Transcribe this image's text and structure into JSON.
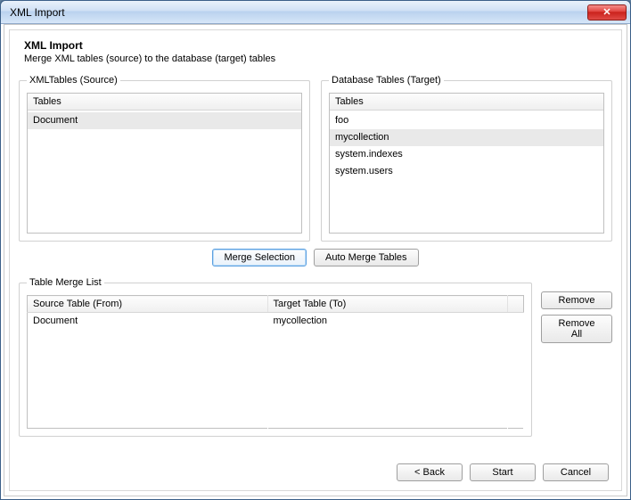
{
  "window": {
    "title": "XML Import"
  },
  "header": {
    "title": "XML Import",
    "subtitle": "Merge XML tables (source) to the database (target) tables"
  },
  "source": {
    "legend": "XMLTables (Source)",
    "column": "Tables",
    "items": [
      "Document"
    ],
    "selected_index": 0
  },
  "target": {
    "legend": "Database Tables (Target)",
    "column": "Tables",
    "items": [
      "foo",
      "mycollection",
      "system.indexes",
      "system.users"
    ],
    "selected_index": 1
  },
  "action_buttons": {
    "merge_selection": "Merge Selection",
    "auto_merge": "Auto Merge Tables"
  },
  "merge_list": {
    "legend": "Table Merge List",
    "col_source": "Source Table (From)",
    "col_target": "Target Table (To)",
    "rows": [
      {
        "source": "Document",
        "target": "mycollection"
      }
    ]
  },
  "side_buttons": {
    "remove": "Remove",
    "remove_all": "Remove All"
  },
  "footer": {
    "back": "< Back",
    "start": "Start",
    "cancel": "Cancel"
  }
}
